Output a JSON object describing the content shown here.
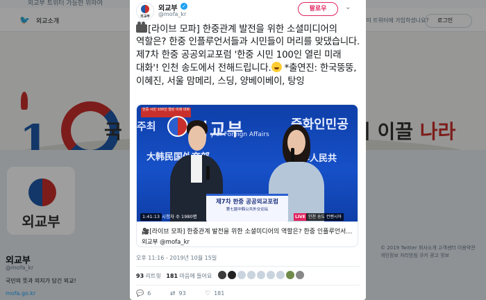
{
  "background": {
    "top_text": "외교부 트위터 가능한 위하여",
    "nav_about": "외교소개",
    "nav_signup_prompt": "이미 트위터에 가입하셨나요?",
    "nav_login": "로그인",
    "banner_text_left": "국",
    "banner_text_right_1": "이 이끌",
    "banner_text_right_2": "나라",
    "avatar_label": "외교부",
    "profile_name": "외교부",
    "profile_handle": "@mofa_kr",
    "profile_bio": "국민의 뜻과 의지가 담긴 외교!",
    "profile_link": "mofa.go.kr",
    "footer_lines": [
      "© 2019 Twitter  회사소개  고객센터  이용약관",
      "개인정보 처리방침  쿠키  광고 정보"
    ]
  },
  "tweet": {
    "avatar_text": "외교부",
    "author_name": "외교부",
    "author_handle": "@mofa_kr",
    "follow_label": "팔로우",
    "text_part1": "[라이브 모파] 한중관계 발전을 위한 소셜미디어의 역할은? 한중 인플루언서들과 시민들이 머리를 맞댔습니다. 제7차 한중 공공외교포럼 '한중 시민 100인 열린 미래 대화'! 인천 송도에서 전해드립니다.",
    "text_part2": " *출연진: 한국뚱뚱, 이혜진, 서울 맘메리, 스딩, 양베이베이, 탕잉",
    "card": {
      "badge_text": "한중 시민 100인 열린 미래 대화",
      "backdrop_left": "주최",
      "backdrop_ko": "외교부",
      "backdrop_en": "y of Foreign Affairs",
      "backdrop_cn": "중화인민공",
      "backdrop_cn_left": "大韩民国外交部",
      "backdrop_cn_right": "华人民共",
      "podium_title": "제7차 한중 공공외교포럼",
      "podium_sub": "第七届中韩公共外交论坛",
      "duration": "1:41:13",
      "views": "시청자 수 1980명",
      "live_label": "LIVE",
      "location": "인천 송도 컨벤시아",
      "title": "🎥[라이브 모파] 한중관계 발전을 위한 소셜미디어의 역할은? 한중 인플루언서들...",
      "source": "외교부 @mofa_kr"
    },
    "timestamp": "오후 11:16 - 2019년 10월 15일",
    "retweets_count": "93",
    "retweets_label": "리트윗",
    "likes_count": "181",
    "likes_label": "마음에 들어요",
    "liker_colors": [
      "#3b3b3b",
      "#222222",
      "#c9d4de",
      "#c9d4de",
      "#c9d4de",
      "#c9d4de",
      "#c9d4de",
      "#6f8a4a",
      "#888888"
    ],
    "actions": {
      "replies": "6",
      "retweets": "93",
      "likes": "181"
    }
  },
  "colors": {
    "like": "#e0245e",
    "link": "#1da1f2",
    "muted": "#657786"
  }
}
